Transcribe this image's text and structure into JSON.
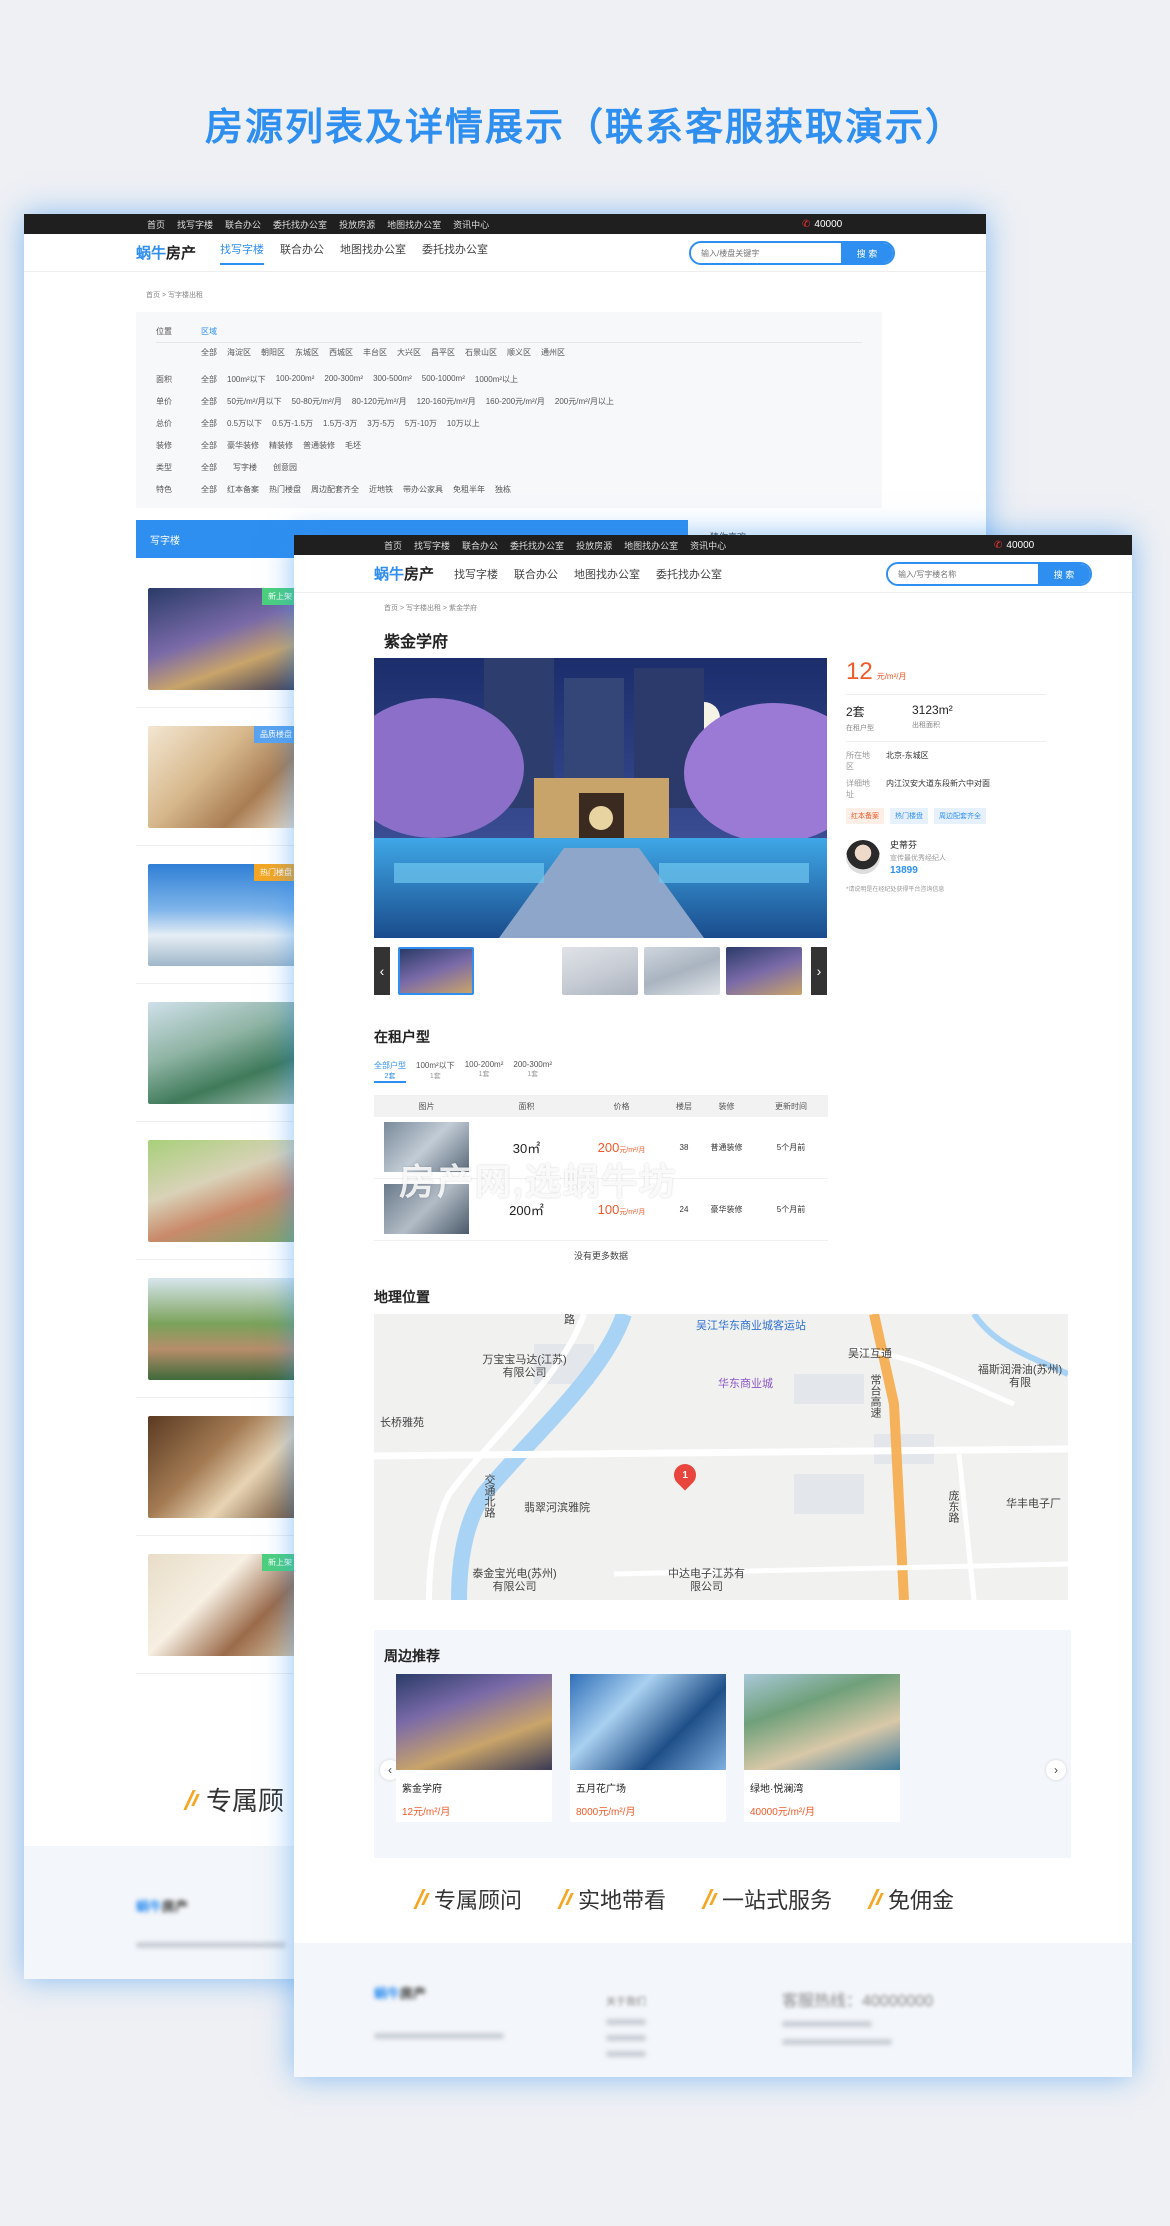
{
  "hero_title": "房源列表及详情展示（联系客服获取演示）",
  "topbar": {
    "links": [
      "首页",
      "找写字楼",
      "联合办公",
      "委托找办公室",
      "投放房源",
      "地图找办公室",
      "资讯中心"
    ],
    "phone": "40000"
  },
  "brand": {
    "logo_a": "蜗牛",
    "logo_b": "房产"
  },
  "nav": [
    "找写字楼",
    "联合办公",
    "地图找办公室",
    "委托找办公室"
  ],
  "search": {
    "placeholder": "输入/楼盘关键字",
    "placeholder_b": "输入/写字楼名称",
    "button": "搜 索"
  },
  "list_page": {
    "breadcrumb": "首页 > 写字楼出租",
    "filters": {
      "location_label": "位置",
      "location_selected": "区域",
      "districts": [
        "全部",
        "海淀区",
        "朝阳区",
        "东城区",
        "西城区",
        "丰台区",
        "大兴区",
        "昌平区",
        "石景山区",
        "顺义区",
        "通州区"
      ],
      "rows": [
        {
          "label": "面积",
          "options": [
            "全部",
            "100m²以下",
            "100-200m²",
            "200-300m²",
            "300-500m²",
            "500-1000m²",
            "1000m²以上"
          ]
        },
        {
          "label": "单价",
          "options": [
            "全部",
            "50元/m²/月以下",
            "50-80元/m²/月",
            "80-120元/m²/月",
            "120-160元/m²/月",
            "160-200元/m²/月",
            "200元/m²/月以上"
          ]
        },
        {
          "label": "总价",
          "options": [
            "全部",
            "0.5万以下",
            "0.5万-1.5万",
            "1.5万-3万",
            "3万-5万",
            "5万-10万",
            "10万以上"
          ]
        },
        {
          "label": "装修",
          "options": [
            "全部",
            "豪华装修",
            "精装修",
            "普通装修",
            "毛坯"
          ]
        },
        {
          "label": "类型",
          "options": [
            "全部",
            "写字楼",
            "创意园"
          ]
        },
        {
          "label": "特色",
          "options": [
            "全部",
            "红本备案",
            "热门楼盘",
            "周边配套齐全",
            "近地铁",
            "带办公家具",
            "免租半年",
            "独栋"
          ]
        }
      ]
    },
    "tab_label": "写字楼",
    "side_title": "猜你喜欢",
    "badges": [
      "新上架",
      "品质楼盘",
      "热门楼盘",
      "新上架"
    ],
    "promo_partial": "专属顾"
  },
  "detail": {
    "breadcrumb": "首页 > 写字楼出租 > 紫金学府",
    "title": "紫金学府",
    "price": "12",
    "price_unit": "元/m²/月",
    "units": "2套",
    "units_label": "在租户型",
    "area": "3123m²",
    "area_label": "出租面积",
    "district_label": "所在地区",
    "district": "北京-东城区",
    "address_label": "详细地址",
    "address": "内江汉安大道东段新六中对面",
    "tags": [
      "红本备案",
      "热门楼盘",
      "周边配套齐全"
    ],
    "agent": {
      "name": "史蒂芬",
      "role": "宣传最优秀经纪人",
      "phone": "13899"
    },
    "note": "*请说明是在经纪处获得平台咨询信息",
    "units_section": "在租户型",
    "unit_tabs": [
      {
        "label": "全部户型",
        "count": "2套"
      },
      {
        "label": "100m²以下",
        "count": "1套"
      },
      {
        "label": "100-200m²",
        "count": "1套"
      },
      {
        "label": "200-300m²",
        "count": "1套"
      }
    ],
    "table_head": [
      "图片",
      "面积",
      "价格",
      "楼层",
      "装修",
      "更新时间"
    ],
    "table_rows": [
      {
        "area": "30㎡",
        "price": "200",
        "price_unit": "元/m²/月",
        "floor": "38",
        "deco": "普通装修",
        "time": "5个月前"
      },
      {
        "area": "200㎡",
        "price": "100",
        "price_unit": "元/m²/月",
        "floor": "24",
        "deco": "豪华装修",
        "time": "5个月前"
      }
    ],
    "no_more": "没有更多数据",
    "watermark": "房产网,选蜗牛坊",
    "map_section": "地理位置",
    "map_labels": [
      "吴江华东商业城客运站",
      "华东商业城",
      "万宝宝马达(江苏)有限公司",
      "长桥雅苑",
      "交通北路",
      "翡翠河滨雅院",
      "泰金宝光电(苏州)有限公司",
      "中达电子江苏有限公司",
      "吴江互通",
      "常台高速",
      "福斯润滑油(苏州)有限",
      "庞东路",
      "华丰电子厂",
      "路"
    ],
    "map_pin": "1",
    "nearby_section": "周边推荐",
    "nearby": [
      {
        "name": "紫金学府",
        "price": "12元/m²/月"
      },
      {
        "name": "五月花广场",
        "price": "8000元/m²/月"
      },
      {
        "name": "绿地·悦澜湾",
        "price": "40000元/m²/月"
      }
    ],
    "promos": [
      "专属顾问",
      "实地带看",
      "一站式服务",
      "免佣金"
    ],
    "footer": {
      "col_about": "关于我们",
      "hotline": "客服热线：40000000"
    }
  },
  "colors": {
    "accent": "#2f8ff0",
    "price": "#f05a28",
    "topbar": "#1f1f1f"
  }
}
